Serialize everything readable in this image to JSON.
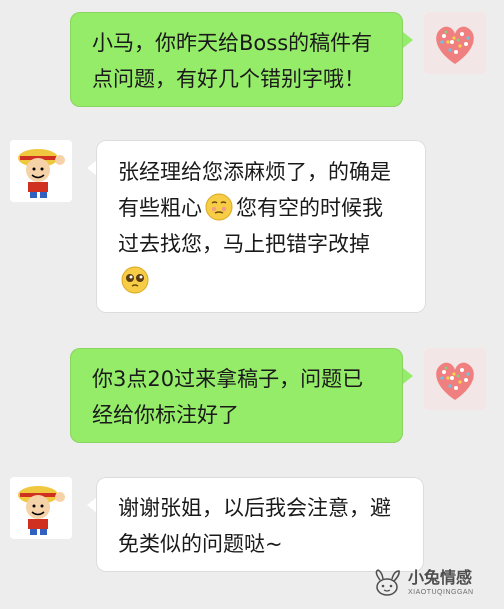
{
  "messages": [
    {
      "side": "right",
      "text": "小马，你昨天给Boss的稿件有点问题，有好几个错别字哦！"
    },
    {
      "side": "left",
      "line1": "张经理给您添麻烦了，的确是",
      "line2_a": "有些粗心",
      "line2_b": "您有空的时候我",
      "line3": "过去找您，马上把错字改掉",
      "emoji1": "embarrassed-emoji",
      "emoji2": "pleading-emoji"
    },
    {
      "side": "right",
      "text": "你3点20过来拿稿子，问题已经给你标注好了"
    },
    {
      "side": "left",
      "text": "谢谢张姐，以后我会注意，避免类似的问题哒~"
    }
  ],
  "watermark": {
    "main": "小兔情感",
    "sub": "XIAOTUQINGGAN"
  },
  "colors": {
    "sent_bubble": "#95ec69",
    "received_bubble": "#ffffff",
    "background": "#ededed"
  }
}
